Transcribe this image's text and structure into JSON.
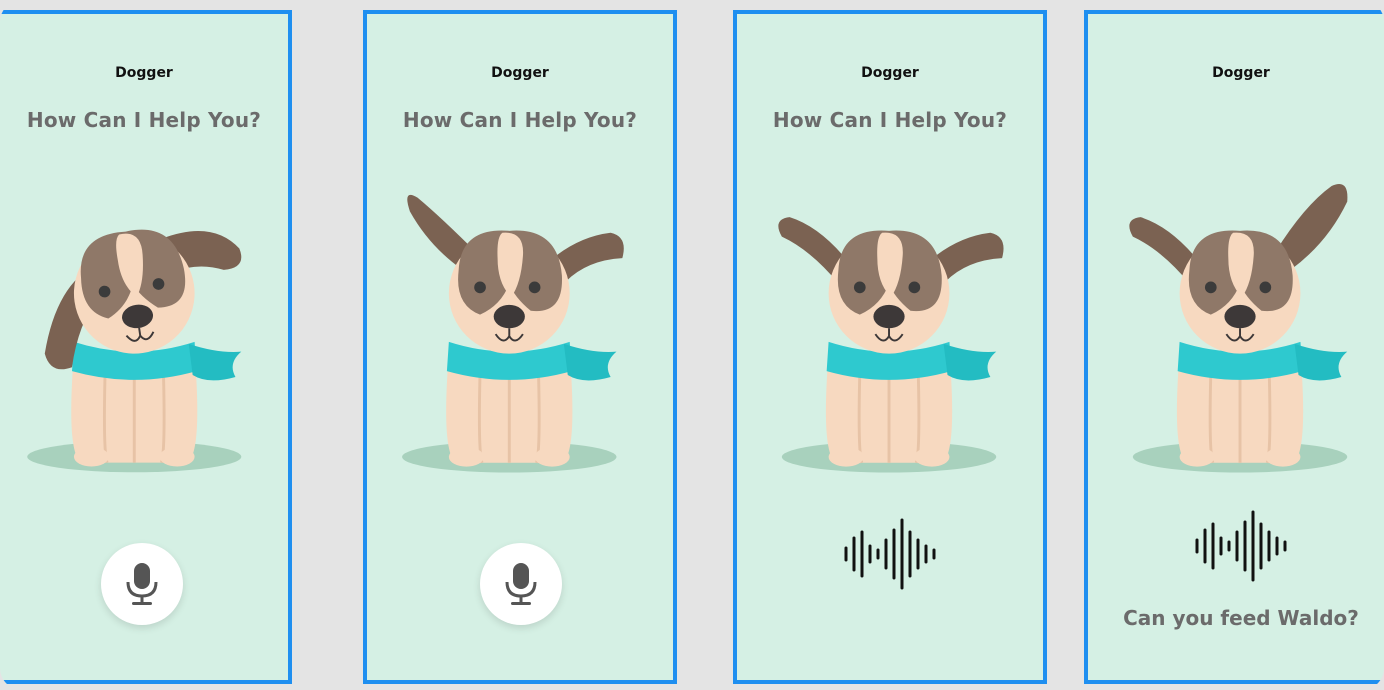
{
  "app": {
    "name": "Dogger"
  },
  "screens": [
    {
      "id": "idle-1",
      "title": "Dogger",
      "heading": "How Can I Help You?",
      "control": "microphone-button"
    },
    {
      "id": "idle-2",
      "title": "Dogger",
      "heading": "How Can I Help You?",
      "control": "microphone-button"
    },
    {
      "id": "listening",
      "title": "Dogger",
      "heading": "How Can I Help You?",
      "control": "voice-waveform"
    },
    {
      "id": "result",
      "title": "Dogger",
      "heading": "",
      "control": "voice-waveform",
      "transcript": "Can you feed Waldo?"
    }
  ],
  "icons": {
    "mic": "microphone-icon",
    "wave": "sound-wave-icon"
  },
  "colors": {
    "frame_border": "#1e8ff0",
    "screen_bg": "#d5f0e4",
    "page_bg": "#e4e4e4",
    "heading_text": "#6b6b6b",
    "dog_ear": "#7b6252",
    "dog_patch": "#8f7868",
    "dog_body": "#f7d9c0",
    "scarf": "#2ec9cf"
  }
}
